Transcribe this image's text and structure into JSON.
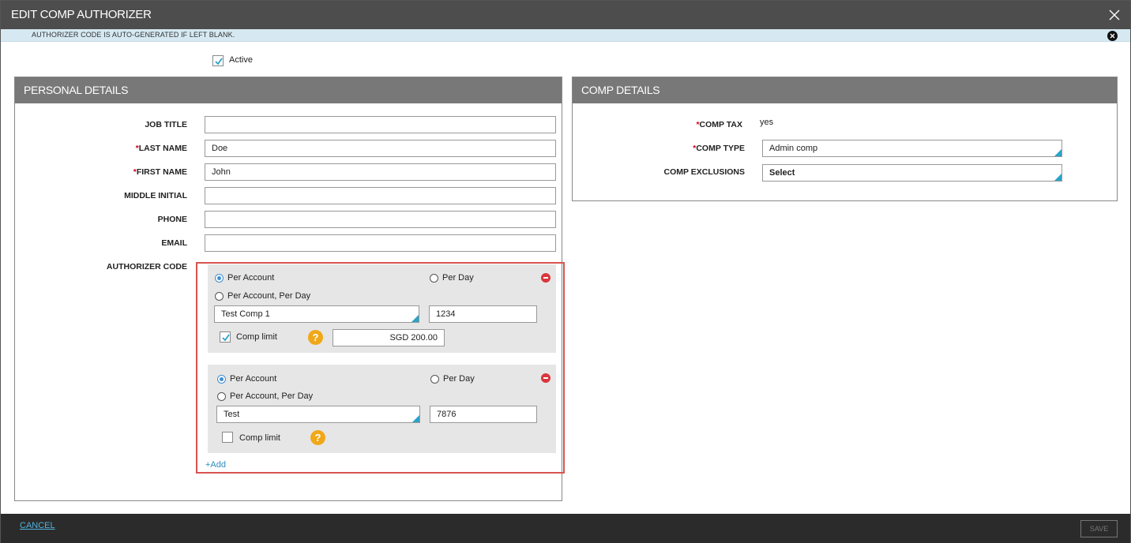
{
  "modal": {
    "title": "EDIT COMP AUTHORIZER",
    "info_message": "AUTHORIZER CODE IS AUTO-GENERATED IF LEFT BLANK.",
    "active_label": "Active",
    "active_checked": true
  },
  "personal": {
    "heading": "PERSONAL DETAILS",
    "job_title_label": "JOB TITLE",
    "job_title_value": "",
    "last_name_label": "LAST NAME",
    "last_name_value": "Doe",
    "first_name_label": "FIRST NAME",
    "first_name_value": "John",
    "middle_initial_label": "MIDDLE INITIAL",
    "middle_initial_value": "",
    "phone_label": "PHONE",
    "phone_value": "",
    "email_label": "EMAIL",
    "email_value": "",
    "authorizer_code_label": "AUTHORIZER CODE",
    "required_marker": "*"
  },
  "authorizer_codes": [
    {
      "per_account_label": "Per Account",
      "per_day_label": "Per Day",
      "per_account_per_day_label": "Per Account, Per Day",
      "selected": "Per Account",
      "comp_select": "Test Comp 1",
      "code": "1234",
      "comp_limit_label": "Comp limit",
      "comp_limit_checked": true,
      "comp_limit_value": "SGD 200.00"
    },
    {
      "per_account_label": "Per Account",
      "per_day_label": "Per Day",
      "per_account_per_day_label": "Per Account, Per Day",
      "selected": "Per Account",
      "comp_select": "Test",
      "code": "7876",
      "comp_limit_label": "Comp limit",
      "comp_limit_checked": false
    }
  ],
  "add_label": "+Add",
  "help_glyph": "?",
  "comp": {
    "heading": "COMP DETAILS",
    "comp_tax_label": "COMP TAX",
    "comp_tax_value": "yes",
    "comp_type_label": "COMP TYPE",
    "comp_type_value": "Admin comp",
    "comp_exclusions_label": "COMP EXCLUSIONS",
    "comp_exclusions_value": "Select"
  },
  "footer": {
    "cancel_label": "CANCEL",
    "save_label": "SAVE"
  },
  "colors": {
    "titlebar": "#4d4d4d",
    "panel_header": "#787878",
    "accent": "#2aa3c7",
    "highlight_border": "#d9534f",
    "required": "#d0021b",
    "help": "#f0a818"
  }
}
